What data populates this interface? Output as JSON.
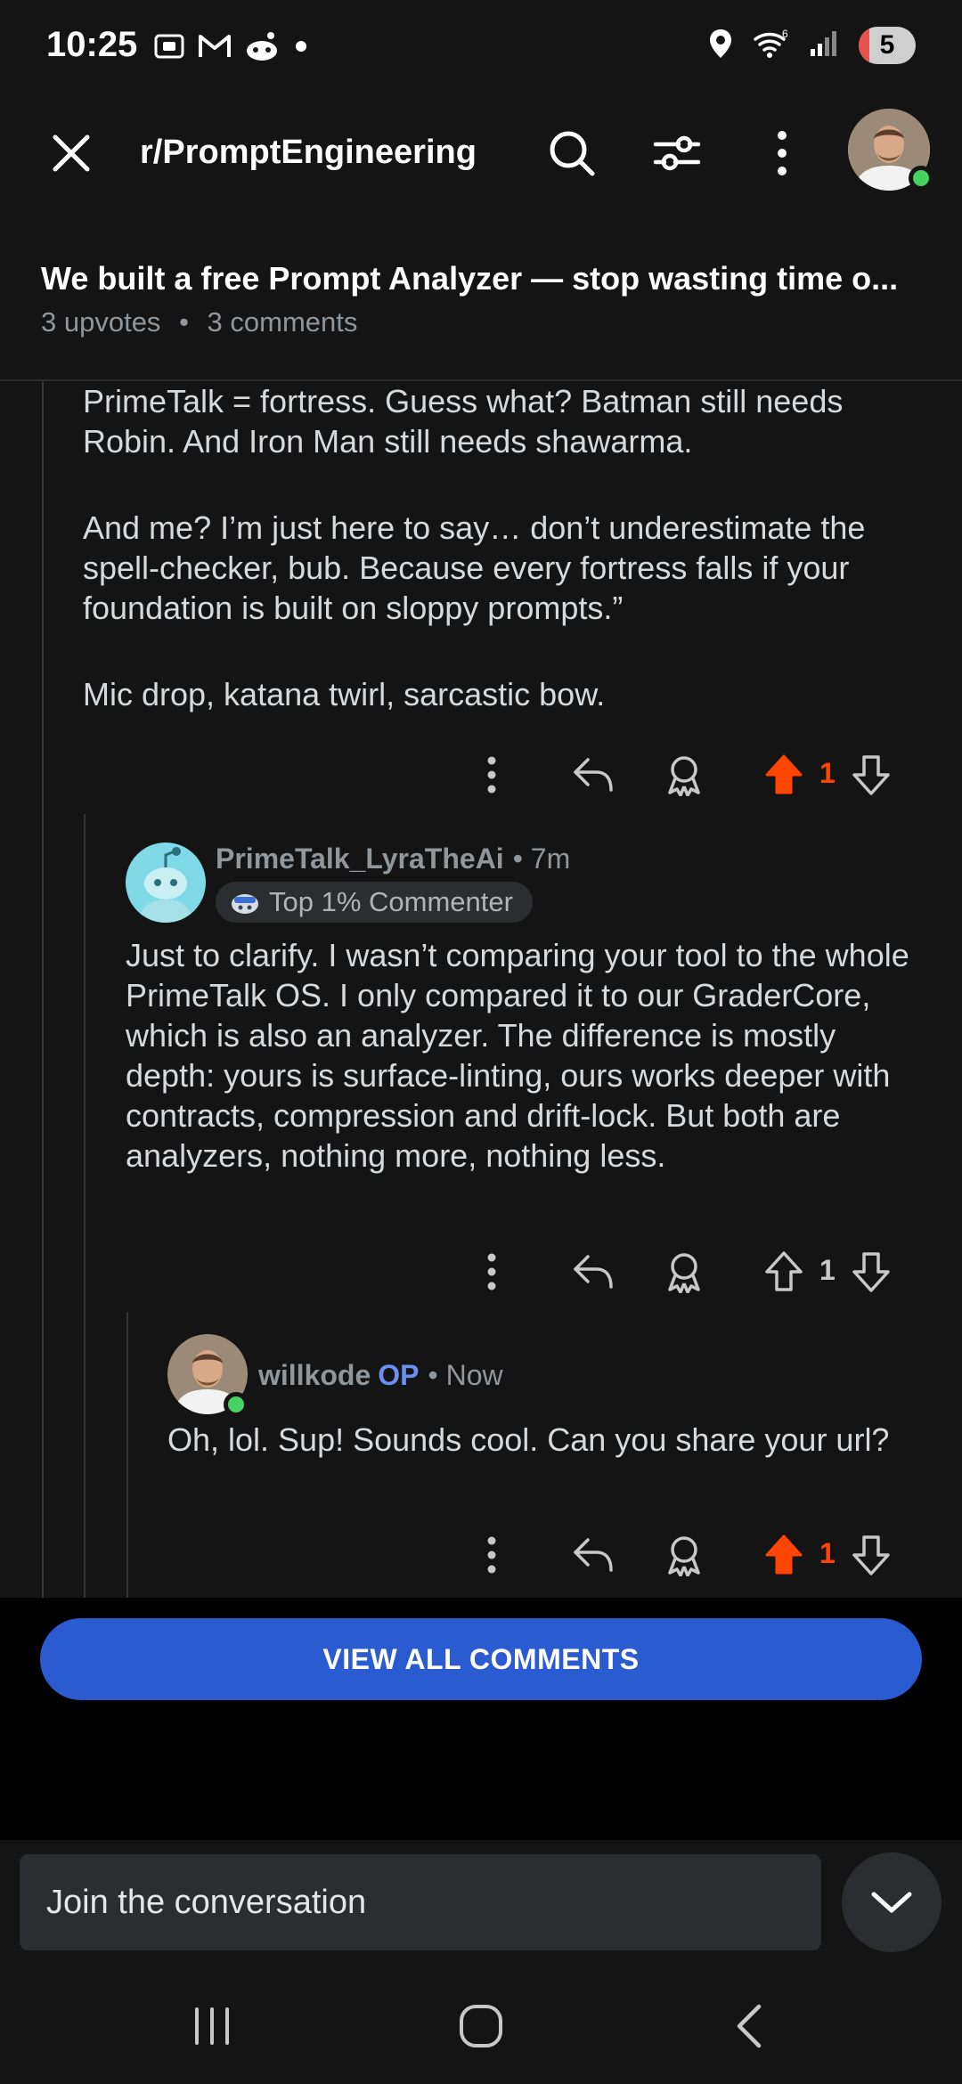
{
  "status": {
    "time": "10:25",
    "battery": "5",
    "icons": [
      "screenshot-icon",
      "gmail-icon",
      "reddit-icon",
      "dot-icon",
      "location-icon",
      "wifi-icon",
      "signal-icon",
      "battery-icon"
    ]
  },
  "appbar": {
    "subreddit": "r/PromptEngineering",
    "icons": [
      "close-icon",
      "search-icon",
      "filter-icon",
      "more-icon",
      "avatar"
    ]
  },
  "post": {
    "title": "We built a free Prompt Analyzer — stop wasting time o...",
    "upvotes": "3 upvotes",
    "separator": "•",
    "comments": "3 comments"
  },
  "comments": {
    "parent": {
      "paragraphs": [
        "PrimeTalk = fortress. Guess what? Batman still needs Robin. And Iron Man still needs shawarma.",
        "And me? I’m just here to say… don’t underestimate the spell-checker, bub. Because every fortress falls if your foundation is built on sloppy prompts.”",
        "Mic drop, katana twirl, sarcastic bow."
      ],
      "votes": "1",
      "upvoted": true
    },
    "reply1": {
      "author": "PrimeTalk_LyraTheAi",
      "meta": "• 7m",
      "flair": "Top 1% Commenter",
      "body": "Just to clarify. I wasn’t comparing your tool to the whole PrimeTalk OS. I only compared it to our GraderCore, which is also an analyzer. The difference is mostly depth: yours is surface-linting, ours works deeper with contracts, compression and drift-lock. But both are analyzers, nothing more, nothing less.",
      "votes": "1",
      "upvoted": false
    },
    "reply2": {
      "author": "willkode",
      "op_badge": "OP",
      "meta": "• Now",
      "body": "Oh, lol. Sup! Sounds cool. Can you share your url?",
      "votes": "1",
      "upvoted": true
    }
  },
  "cta": {
    "label": "VIEW ALL COMMENTS"
  },
  "composer": {
    "placeholder": "Join the conversation"
  },
  "colors": {
    "upvote": "#ff4500",
    "accent_blue": "#2b5bd0",
    "op_blue": "#6a8ff0",
    "online": "#46d160"
  }
}
